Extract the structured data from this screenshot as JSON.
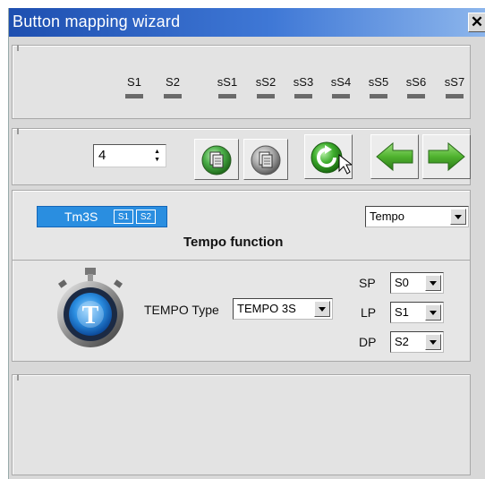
{
  "window": {
    "title": "Button mapping wizard",
    "close_glyph": "✕"
  },
  "signals": [
    "S1",
    "S2",
    "sS1",
    "sS2",
    "sS3",
    "sS4",
    "sS5",
    "sS6",
    "sS7"
  ],
  "toolbar": {
    "spinner_value": "4",
    "icons": [
      "copy-icon",
      "paste-icon",
      "refresh-icon",
      "arrow-left-icon",
      "arrow-right-icon"
    ]
  },
  "function_bar": {
    "label": "Tm3S",
    "tags": [
      "S1",
      "S2"
    ]
  },
  "function_select": {
    "value": "Tempo"
  },
  "function_title": "Tempo function",
  "tempo": {
    "type_label": "TEMPO Type",
    "type_value": "TEMPO 3S",
    "params": [
      {
        "label": "SP",
        "value": "S0"
      },
      {
        "label": "LP",
        "value": "S1"
      },
      {
        "label": "DP",
        "value": "S2"
      }
    ]
  },
  "colors": {
    "title_bar": "#1e4fb0",
    "accent_blue": "#2a8ee0",
    "green": "#3a9a2a"
  }
}
